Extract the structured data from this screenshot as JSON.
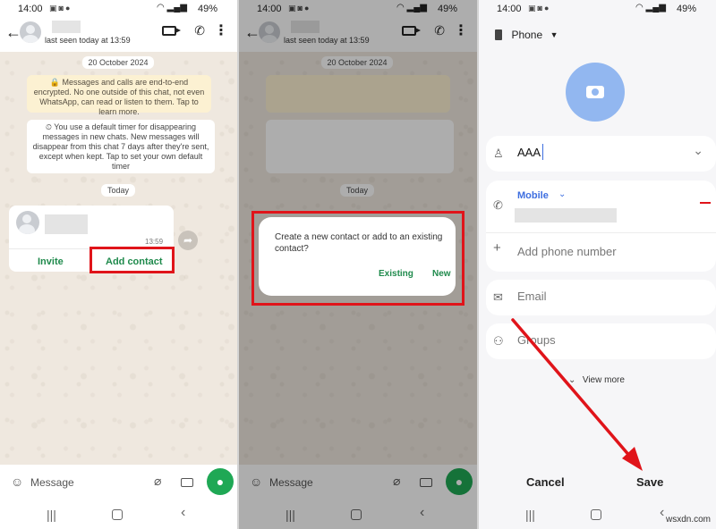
{
  "status": {
    "time": "14:00",
    "battery": "49%"
  },
  "p1": {
    "last_seen": "last seen today at 13:59",
    "date": "20 October 2024",
    "encryption": "🔒 Messages and calls are end-to-end encrypted. No one outside of this chat, not even WhatsApp, can read or listen to them. Tap to learn more.",
    "timer": "⏲ You use a default timer for disappearing messages in new chats. New messages will disappear from this chat 7 days after they're sent, except when kept. Tap to set your own default timer",
    "today": "Today",
    "msg_time": "13:59",
    "invite": "Invite",
    "add_contact": "Add contact",
    "message_placeholder": "Message"
  },
  "p2": {
    "last_seen": "last seen today at 13:59",
    "date": "20 October 2024",
    "today": "Today",
    "dialog_text": "Create a new contact or add to an existing contact?",
    "existing": "Existing",
    "new": "New",
    "message_placeholder": "Message"
  },
  "p3": {
    "account": "Phone",
    "name_value": "AAA",
    "phone_type": "Mobile",
    "add_phone": "Add phone number",
    "email": "Email",
    "groups": "Groups",
    "view_more": "View more",
    "cancel": "Cancel",
    "save": "Save"
  },
  "watermark": "wsxdn.com",
  "colors": {
    "whatsapp_green": "#1fa855",
    "accent_red": "#e0141a",
    "samsung_blue": "#3d6ee0"
  }
}
